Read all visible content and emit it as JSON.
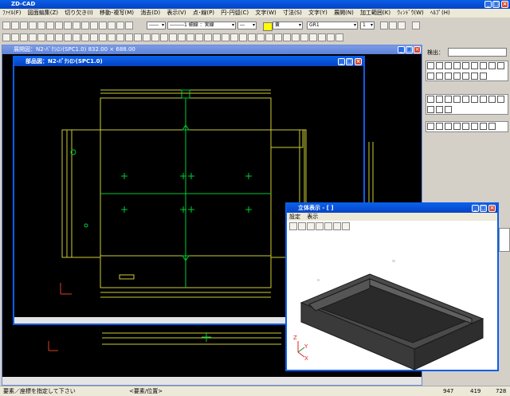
{
  "app": {
    "title": "ZD-CAD",
    "menu": [
      "ﾌｧｲﾙ(F)",
      "図面編集(Z)",
      "切り欠き(I)",
      "移動･複写(M)",
      "消去(D)",
      "表示(V)",
      "点･線(P)",
      "円･円弧(C)",
      "文字(W)",
      "寸法(S)",
      "文字(Y)",
      "展開(N)",
      "加工範囲(K)",
      "ｳｨﾝﾄﾞｳ(W)",
      "ﾍﾙﾌﾟ(H)"
    ]
  },
  "toolbar": {
    "line_type_value": "――",
    "line_style_value": "―――1 細線 ：実線",
    "line_end_value": "―",
    "color_value": "黄",
    "layer_value": "GR1",
    "layer_num_value": "1"
  },
  "side_panel": {
    "search_label": "検出："
  },
  "develop_window": {
    "title": "展開図：N2-ﾊﾞｸｼﾛﾝ(SPC1.0) 832.00 × 688.00"
  },
  "part_window": {
    "title": "部品図：N2-ﾊﾞｸｼﾛﾝ(SPC1.0)"
  },
  "view3d_window": {
    "title": "立体表示 - [ ]",
    "menu": [
      "設定",
      "表示"
    ],
    "axis_z": "Z",
    "axis_y": "Y",
    "axis_x": "X"
  },
  "statusbar": {
    "prompt": "要素／座標を指定して下さい",
    "mode": "<要素/位置>",
    "x": "947",
    "y": "419",
    "z": "728"
  },
  "colors": {
    "titlebar": "#0a5ee8",
    "cad_bg": "#000000",
    "drawing_green": "#00cc33",
    "drawing_yellow": "#cccc33",
    "model_gray": "#3a3a3a"
  }
}
